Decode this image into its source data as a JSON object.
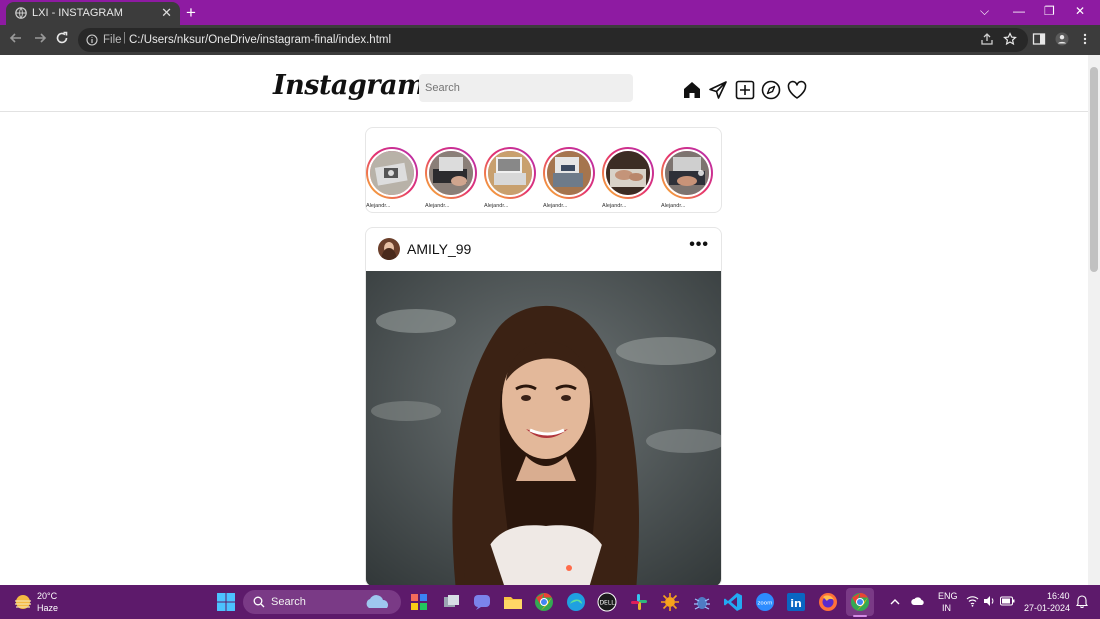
{
  "browser": {
    "tab_title": "LXI - INSTAGRAM",
    "tab_close": "✕",
    "new_tab": "+",
    "file_label": "File",
    "url": "C:/Users/nksur/OneDrive/instagram-final/index.html",
    "window_controls": [
      "⌵",
      "—",
      "❐",
      "✕"
    ]
  },
  "instagram": {
    "logo": "Instagram",
    "search_placeholder": "Search",
    "nav_icons": [
      "home-icon",
      "send-icon",
      "add-post-icon",
      "explore-icon",
      "heart-icon"
    ],
    "stories": [
      {
        "name": "Alejandr..."
      },
      {
        "name": "Alejandr..."
      },
      {
        "name": "Alejandr..."
      },
      {
        "name": "Alejandr..."
      },
      {
        "name": "Alejandr..."
      },
      {
        "name": "Alejandr..."
      }
    ],
    "post": {
      "username": "AMILY_99",
      "more": "•••"
    }
  },
  "taskbar": {
    "weather_temp": "20°C",
    "weather_desc": "Haze",
    "search_label": "Search",
    "lang_top": "ENG",
    "lang_bottom": "IN",
    "time": "16:40",
    "date": "27-01-2024"
  },
  "colors": {
    "tab_strip": "#8e1ba2",
    "taskbar": "#5d1a6b",
    "story_ring": "#e4326f"
  }
}
